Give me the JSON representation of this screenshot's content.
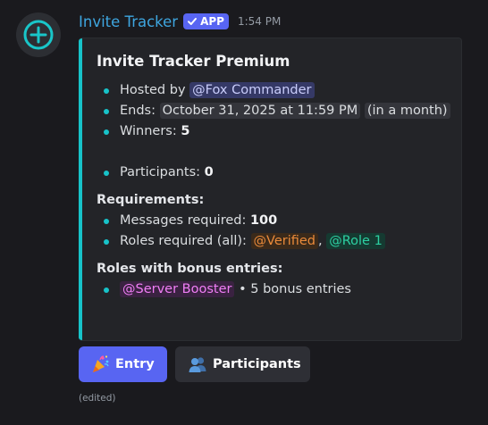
{
  "message": {
    "author": "Invite Tracker",
    "badge_label": "APP",
    "timestamp": "1:54 PM",
    "edited_label": "(edited)"
  },
  "embed": {
    "accent_color": "#17c3c9",
    "title": "Invite Tracker Premium",
    "hosted_by_label": "Hosted by",
    "host_mention": "@Fox Commander",
    "ends_label": "Ends:",
    "ends_date": "October 31, 2025 at 11:59 PM",
    "ends_relative": "(in a month)",
    "winners_label": "Winners:",
    "winners_count": "5",
    "participants_label": "Participants:",
    "participants_count": "0",
    "requirements_heading": "Requirements:",
    "messages_required_label": "Messages required:",
    "messages_required_count": "100",
    "roles_required_label": "Roles required (all):",
    "role_verified": "@Verified",
    "role_separator": ",",
    "role_1": "@Role 1",
    "bonus_heading": "Roles with bonus entries:",
    "bonus_role": "@Server Booster",
    "bonus_text": "• 5 bonus entries"
  },
  "buttons": {
    "entry_label": "Entry",
    "entry_icon": "party-popper-icon",
    "participants_label": "Participants",
    "participants_icon": "busts-in-silhouette-icon"
  },
  "colors": {
    "username": "#3ea6e0",
    "blurple": "#5865f2",
    "background": "#1a1a1e"
  }
}
